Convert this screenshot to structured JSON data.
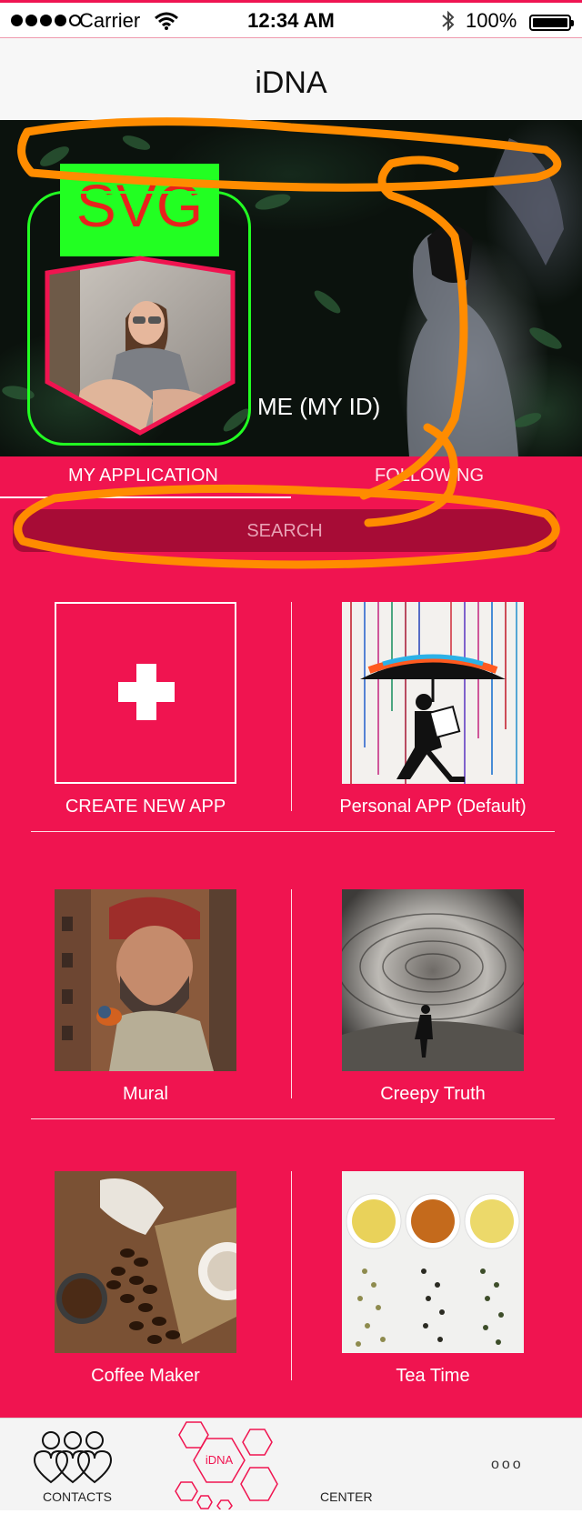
{
  "status_bar": {
    "carrier": "Carrier",
    "time": "12:34 AM",
    "battery": "100%"
  },
  "nav": {
    "title": "iDNA"
  },
  "hero": {
    "svg_placeholder": "SVG",
    "profile_label": "ME (MY ID)"
  },
  "tabs": [
    {
      "label": "MY APPLICATION",
      "active": true
    },
    {
      "label": "FOLLOWING",
      "active": false
    }
  ],
  "search": {
    "placeholder": "SEARCH"
  },
  "apps": [
    {
      "label": "CREATE NEW APP",
      "icon": "plus-icon"
    },
    {
      "label": "Personal APP (Default)"
    },
    {
      "label": "Mural"
    },
    {
      "label": "Creepy Truth"
    },
    {
      "label": "Coffee Maker"
    },
    {
      "label": "Tea Time"
    }
  ],
  "tab_bar": {
    "contacts": "CONTACTS",
    "idna": "iDNA",
    "center": "CENTER",
    "more": "ooo"
  },
  "colors": {
    "accent": "#f01450",
    "search_bg": "#a70c36",
    "annotation_orange": "#ff8c00",
    "annotation_green": "#22ff22"
  }
}
